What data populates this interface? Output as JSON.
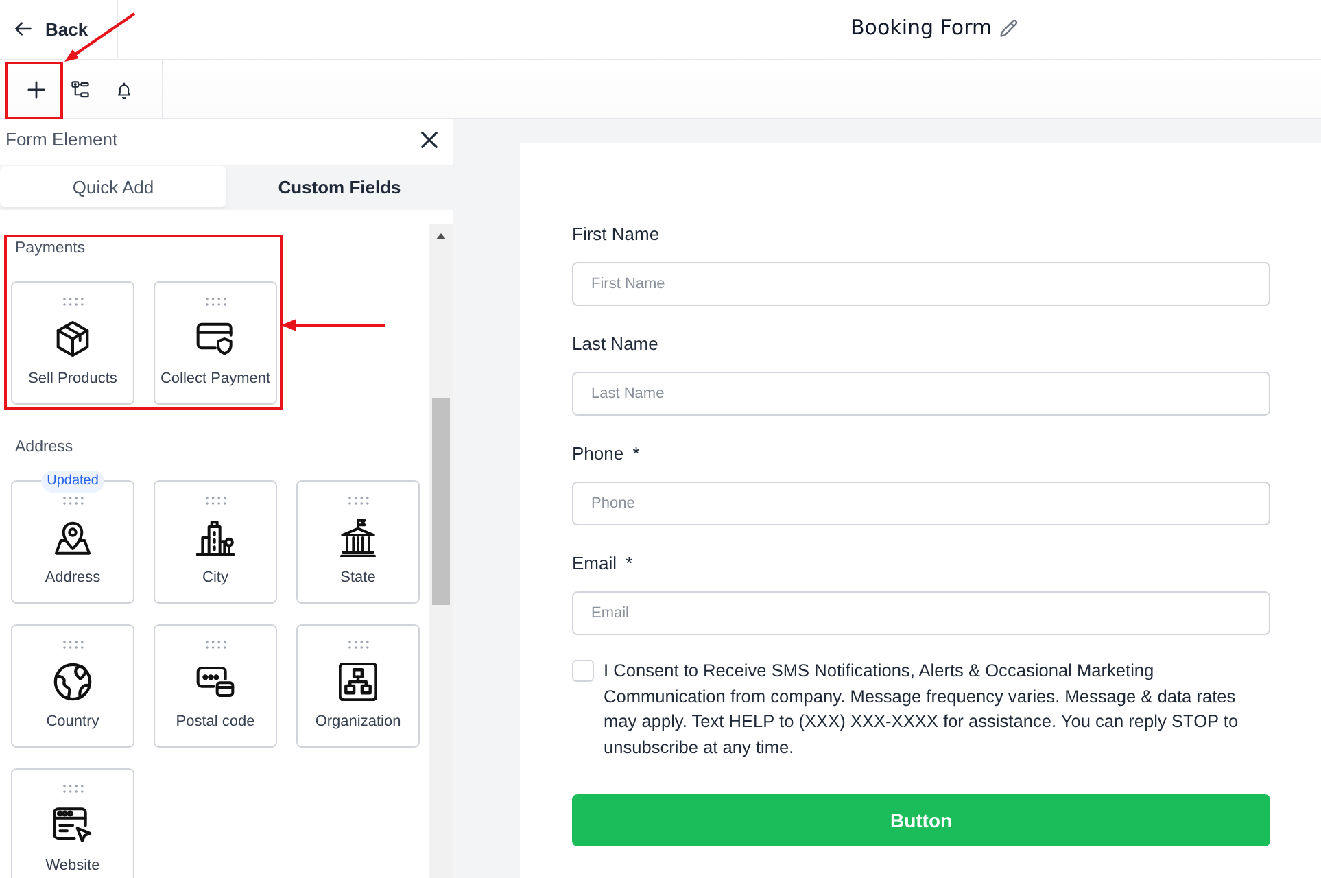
{
  "header": {
    "back": "Back",
    "title": "Booking Form"
  },
  "toolbar": {
    "buttons": [
      {
        "kind": "add"
      },
      {
        "kind": "nodes"
      },
      {
        "kind": "bell"
      }
    ]
  },
  "panel": {
    "title": "Form Element",
    "tabs": [
      {
        "label": "Quick Add",
        "selected": true
      },
      {
        "label": "Custom Fields",
        "selected": false
      }
    ],
    "sections": [
      {
        "title": "Payments",
        "items": [
          {
            "label": "Sell Products",
            "kind": "box"
          },
          {
            "label": "Collect Payment",
            "kind": "card"
          }
        ]
      },
      {
        "title": "Address",
        "items": [
          {
            "label": "Address",
            "kind": "pin",
            "badge": "Updated"
          },
          {
            "label": "City",
            "kind": "city"
          },
          {
            "label": "State",
            "kind": "capitol"
          },
          {
            "label": "Country",
            "kind": "globe"
          },
          {
            "label": "Postal code",
            "kind": "postal"
          },
          {
            "label": "Organization",
            "kind": "org"
          },
          {
            "label": "Website",
            "kind": "web"
          }
        ]
      }
    ]
  },
  "form": {
    "fields": [
      {
        "label": "First Name",
        "placeholder": "First Name"
      },
      {
        "label": "Last Name",
        "placeholder": "Last Name"
      },
      {
        "label": "Phone",
        "required_mark": "*",
        "placeholder": "Phone"
      },
      {
        "label": "Email",
        "required_mark": "*",
        "placeholder": "Email"
      }
    ],
    "consent": {
      "checked": false,
      "text": "I Consent to Receive SMS Notifications, Alerts & Occasional Marketing Communication from company. Message frequency varies. Message & data rates may apply. Text HELP to (XXX) XXX-XXXX for assistance. You can reply STOP to unsubscribe at any time."
    },
    "button": "Button"
  }
}
